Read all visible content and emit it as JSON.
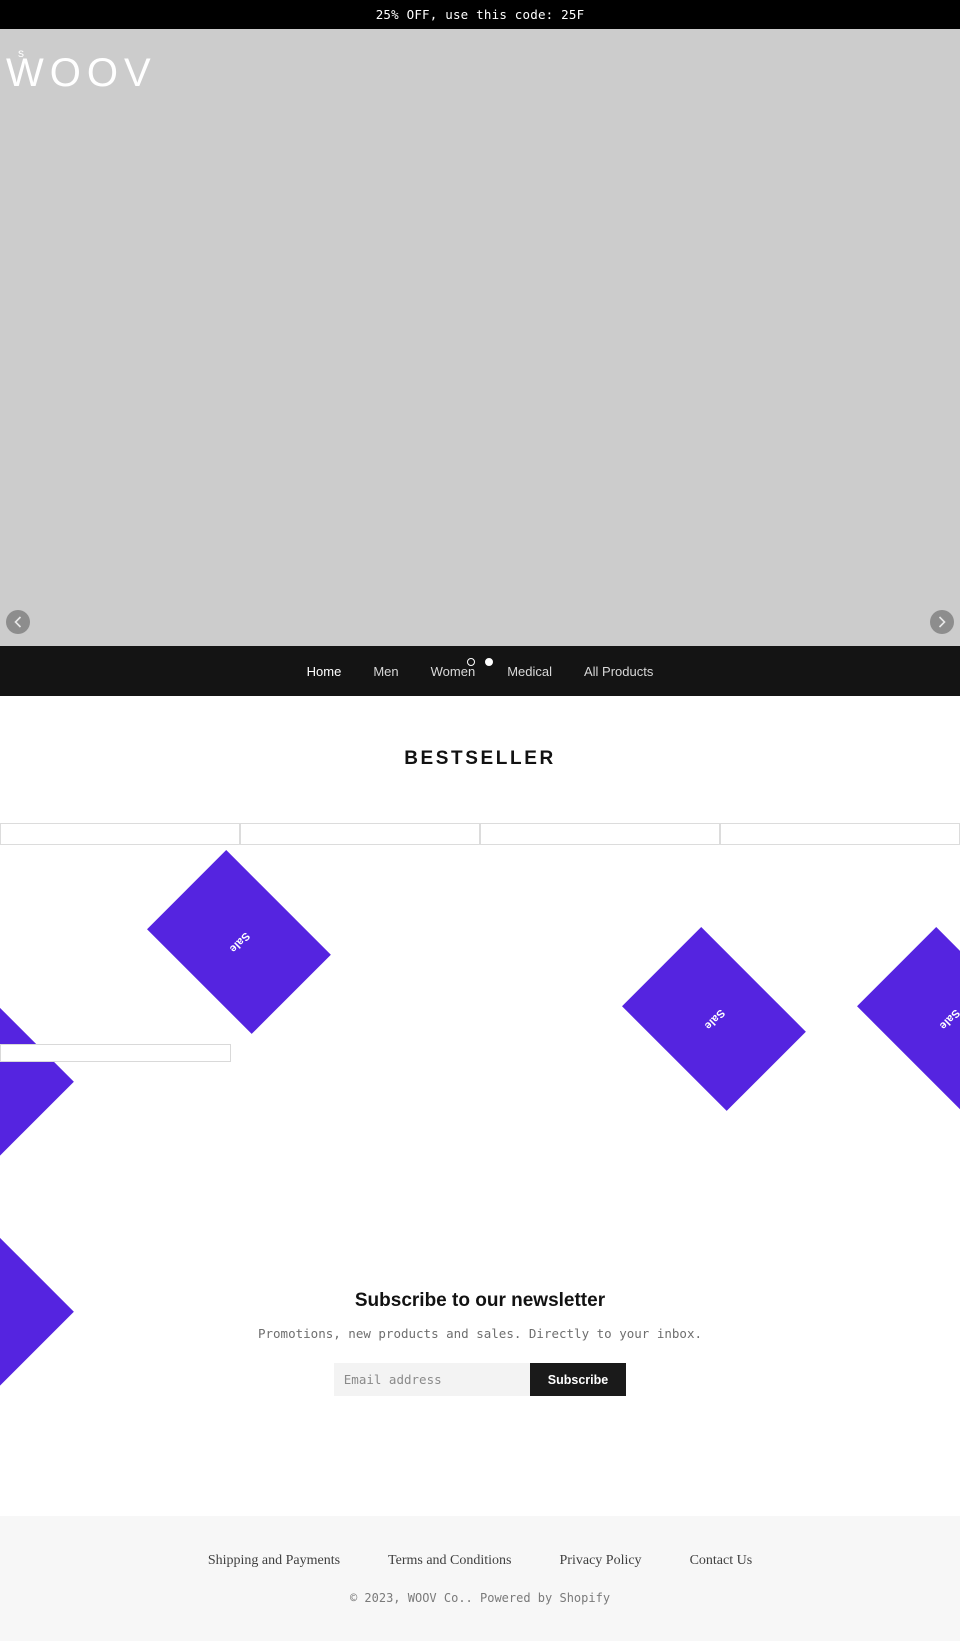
{
  "announcement": {
    "text": "25% OFF, use this code: 25F"
  },
  "hero": {
    "logo_superscript": "s",
    "logo_word": "WOOV",
    "prev_label": "‹",
    "next_label": "›",
    "dots": [
      {
        "active": false
      },
      {
        "active": true
      }
    ]
  },
  "nav": {
    "items": [
      {
        "label": "Home",
        "active": true
      },
      {
        "label": "Men",
        "active": false
      },
      {
        "label": "Women",
        "active": false
      },
      {
        "label": "Medical",
        "active": false
      },
      {
        "label": "All Products",
        "active": false
      }
    ]
  },
  "bestseller": {
    "title": "BESTSELLER",
    "badge_label": "Sale",
    "products": [
      {
        "badge": "Sale"
      },
      {
        "badge": "Sale"
      },
      {
        "badge": "Sale"
      },
      {
        "badge": "Sale"
      }
    ]
  },
  "newsletter": {
    "title": "Subscribe to our newsletter",
    "subtitle": "Promotions, new products and sales. Directly to your inbox.",
    "email_value": "",
    "email_placeholder": "Email address",
    "button_label": "Subscribe"
  },
  "footer": {
    "links": [
      {
        "label": "Shipping and Payments"
      },
      {
        "label": "Terms and Conditions"
      },
      {
        "label": "Privacy Policy"
      },
      {
        "label": "Contact Us"
      }
    ],
    "copyright": "© 2023, WOOV Co.. Powered by Shopify"
  },
  "colors": {
    "announcement_bg": "#000000",
    "hero_bg": "#cccccc",
    "nav_bg": "#141414",
    "sale_badge": "#5524e0",
    "footer_bg": "#f7f7f7",
    "button_bg": "#1a1a1a"
  }
}
